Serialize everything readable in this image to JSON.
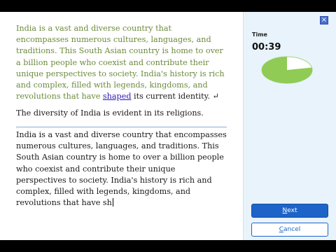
{
  "exercise": {
    "target_before_link": "India is a vast and diverse country that encompasses numerous cultures, languages, and traditions. This South Asian country is home to over a billion people who coexist and contribute their unique perspectives to society. India's history is rich and complex, filled with legends, kingdoms, and revolutions that have ",
    "target_link_word": "shaped",
    "target_after_link": " its current identity.",
    "paragraph_mark": "↵",
    "next_sentence": "The diversity of India is evident in its religions.",
    "typed_text": "India is a vast and diverse country that encompasses numerous cultures, languages, and traditions. This South Asian country is home to over a billion people who coexist and contribute their unique perspectives to society. India's history is rich and complex, filled with legends, kingdoms, and revolutions that have sh"
  },
  "sidebar": {
    "close_icon": "close-icon",
    "close_symbol": "×",
    "time_label": "Time",
    "time_value": "00:39",
    "time_elapsed_fraction": 0.78,
    "pie_colors": {
      "elapsed": "#8fcb55",
      "remaining": "#ffffff",
      "border": "#a9d27c"
    },
    "next_prefix": "",
    "next_mnemonic": "N",
    "next_rest": "ext",
    "cancel_mnemonic": "C",
    "cancel_rest": "ancel"
  },
  "colors": {
    "accent": "#1e64c8",
    "target_text": "#6c8a3c",
    "sidebar_bg": "#e8f3fb"
  }
}
